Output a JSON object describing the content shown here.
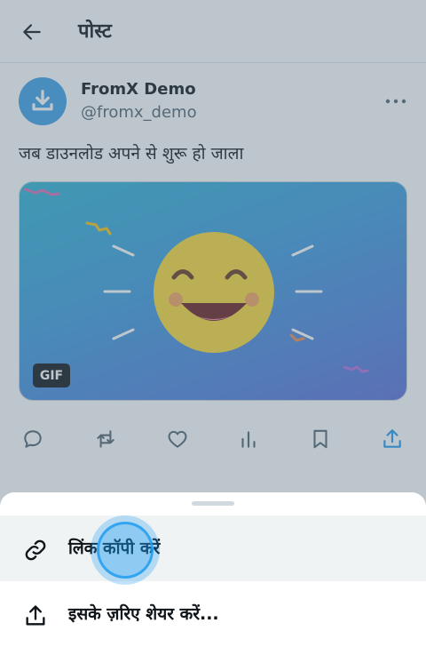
{
  "header": {
    "title": "पोस्ट"
  },
  "post": {
    "display_name": "FromX Demo",
    "handle": "@fromx_demo",
    "text": "जब डाउनलोड अपने से शुरू हो जाला",
    "media_badge": "GIF",
    "avatar_color": "#3f9fe6"
  },
  "actions": [
    {
      "icon": "reply-icon"
    },
    {
      "icon": "repost-icon"
    },
    {
      "icon": "like-icon"
    },
    {
      "icon": "views-icon"
    },
    {
      "icon": "bookmark-icon"
    },
    {
      "icon": "share-icon"
    }
  ],
  "share_sheet": {
    "items": [
      {
        "icon": "link-icon",
        "label": "लिंक कॉपी करें"
      },
      {
        "icon": "share-icon",
        "label": "इसके ज़रिए शेयर करें..."
      }
    ]
  },
  "colors": {
    "accent": "#1d9bf0",
    "text": "#0f1419",
    "muted": "#536471",
    "overlay": "rgba(91,112,131,0.4)"
  }
}
